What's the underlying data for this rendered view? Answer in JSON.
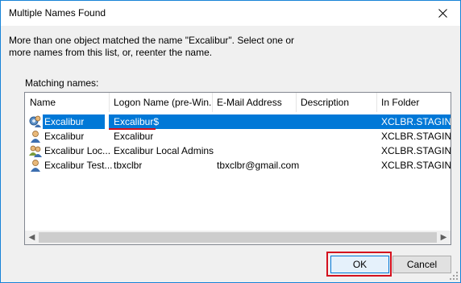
{
  "window": {
    "title": "Multiple Names Found"
  },
  "message": "More than one object matched the name \"Excalibur\". Select one or more names from this list, or, reenter the name.",
  "matching_label": "Matching names:",
  "columns": [
    "Name",
    "Logon Name (pre-Win...",
    "E-Mail Address",
    "Description",
    "In Folder"
  ],
  "rows": [
    {
      "icon": "computer-user-icon",
      "name": "Excalibur",
      "logon": "Excalibur$",
      "email": "",
      "description": "",
      "folder": "XCLBR.STAGIN...",
      "selected": true
    },
    {
      "icon": "user-icon",
      "name": "Excalibur",
      "logon": "Excalibur",
      "email": "",
      "description": "",
      "folder": "XCLBR.STAGIN...",
      "selected": false
    },
    {
      "icon": "group-icon",
      "name": "Excalibur Loc...",
      "logon": "Excalibur Local Admins",
      "email": "",
      "description": "",
      "folder": "XCLBR.STAGIN...",
      "selected": false
    },
    {
      "icon": "user-icon",
      "name": "Excalibur Test...",
      "logon": "tbxclbr",
      "email": "tbxclbr@gmail.com",
      "description": "",
      "folder": "XCLBR.STAGIN...",
      "selected": false
    }
  ],
  "buttons": {
    "ok": "OK",
    "cancel": "Cancel"
  },
  "colors": {
    "selection": "#0078d7",
    "highlight": "#d4101e"
  }
}
